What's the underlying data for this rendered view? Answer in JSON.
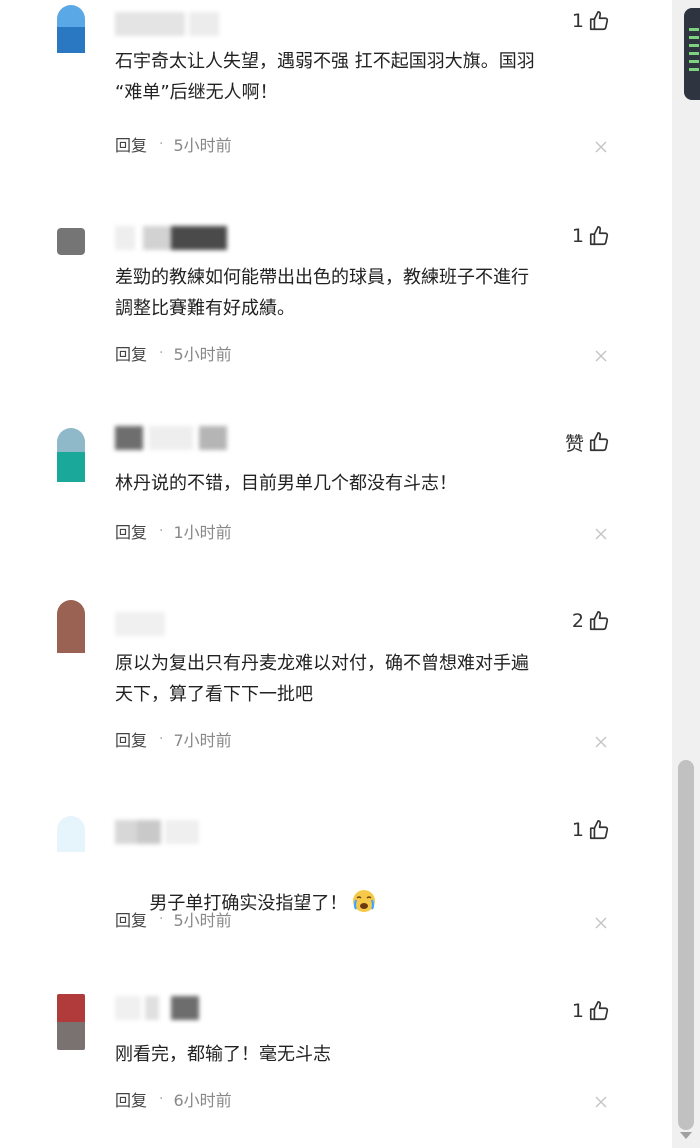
{
  "actions": {
    "reply_label": "回复",
    "dot": "·"
  },
  "comments": [
    {
      "likes": "1",
      "text": "石宇奇太让人失望，遇弱不强 扛不起国羽大旗。国羽\n“难单”后继无人啊！",
      "time": "5小时前"
    },
    {
      "likes": "1",
      "text": "差勁的教練如何能帶出出色的球員，教練班子不進行\n調整比賽難有好成績。",
      "time": "5小时前"
    },
    {
      "likes": "赞",
      "text": "林丹说的不错，目前男单几个都没有斗志！",
      "time": "1小时前"
    },
    {
      "likes": "2",
      "text": "原以为复出只有丹麦龙难以对付，确不曾想难对手遍\n天下，算了看下下一批吧",
      "time": "7小时前"
    },
    {
      "likes": "1",
      "text": "男子单打确实没指望了！",
      "emoji": "crying-face-icon",
      "time": "5小时前"
    },
    {
      "likes": "1",
      "text": "刚看完，都输了！毫无斗志",
      "time": "6小时前"
    }
  ],
  "colors": {
    "text": "#222222",
    "meta": "#888888",
    "avatars": [
      [
        "#5aa9e6",
        "#2a78c2"
      ],
      [
        "#7a7a7a",
        "#7a7a7a"
      ],
      [
        "#8fb8c9",
        "#1aa89a"
      ],
      [
        "#9a6252",
        "#9a6252"
      ],
      [
        "#e6f4fb",
        "#d8eef8"
      ],
      [
        "#b13a3a",
        "#7a7270"
      ]
    ]
  }
}
